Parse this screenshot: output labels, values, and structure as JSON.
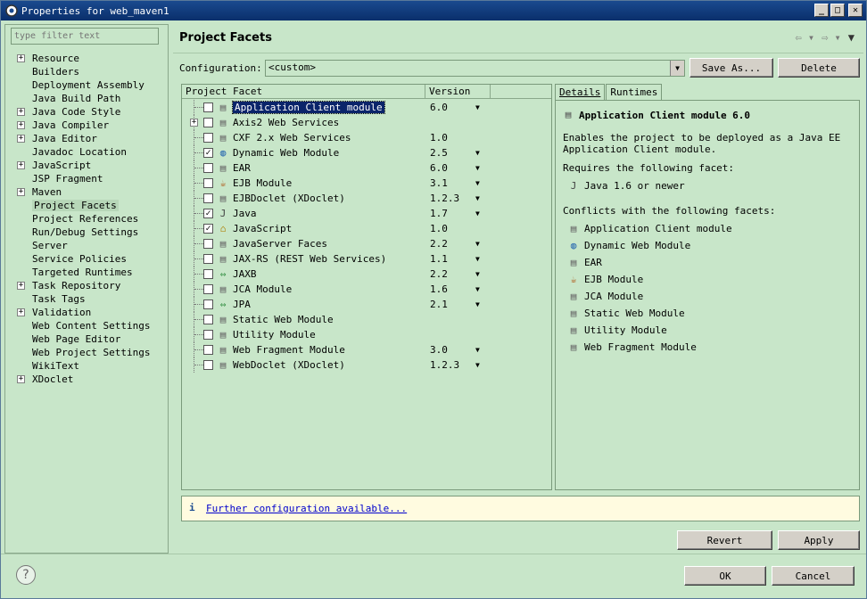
{
  "window": {
    "title": "Properties for web_maven1"
  },
  "sidebar": {
    "filter_placeholder": "type filter text",
    "items": [
      {
        "label": "Resource",
        "expandable": true
      },
      {
        "label": "Builders",
        "expandable": false
      },
      {
        "label": "Deployment Assembly",
        "expandable": false
      },
      {
        "label": "Java Build Path",
        "expandable": false
      },
      {
        "label": "Java Code Style",
        "expandable": true
      },
      {
        "label": "Java Compiler",
        "expandable": true
      },
      {
        "label": "Java Editor",
        "expandable": true
      },
      {
        "label": "Javadoc Location",
        "expandable": false
      },
      {
        "label": "JavaScript",
        "expandable": true
      },
      {
        "label": "JSP Fragment",
        "expandable": false
      },
      {
        "label": "Maven",
        "expandable": true
      },
      {
        "label": "Project Facets",
        "expandable": false,
        "selected": true
      },
      {
        "label": "Project References",
        "expandable": false
      },
      {
        "label": "Run/Debug Settings",
        "expandable": false
      },
      {
        "label": "Server",
        "expandable": false
      },
      {
        "label": "Service Policies",
        "expandable": false
      },
      {
        "label": "Targeted Runtimes",
        "expandable": false
      },
      {
        "label": "Task Repository",
        "expandable": true
      },
      {
        "label": "Task Tags",
        "expandable": false
      },
      {
        "label": "Validation",
        "expandable": true
      },
      {
        "label": "Web Content Settings",
        "expandable": false
      },
      {
        "label": "Web Page Editor",
        "expandable": false
      },
      {
        "label": "Web Project Settings",
        "expandable": false
      },
      {
        "label": "WikiText",
        "expandable": false
      },
      {
        "label": "XDoclet",
        "expandable": true
      }
    ]
  },
  "page": {
    "title": "Project Facets",
    "config_label": "Configuration:",
    "config_value": "<custom>",
    "save_as_label": "Save As...",
    "delete_label": "Delete"
  },
  "facets": {
    "col_facet": "Project Facet",
    "col_version": "Version",
    "rows": [
      {
        "name": "Application Client module",
        "version": "6.0",
        "checked": false,
        "dropdown": true,
        "icon": "page-icon",
        "selected": true
      },
      {
        "name": "Axis2 Web Services",
        "version": "",
        "checked": false,
        "dropdown": false,
        "icon": "page-icon",
        "expandable": true
      },
      {
        "name": "CXF 2.x Web Services",
        "version": "1.0",
        "checked": false,
        "dropdown": false,
        "icon": "page-icon"
      },
      {
        "name": "Dynamic Web Module",
        "version": "2.5",
        "checked": true,
        "dropdown": true,
        "icon": "globe-icon"
      },
      {
        "name": "EAR",
        "version": "6.0",
        "checked": false,
        "dropdown": true,
        "icon": "page-icon"
      },
      {
        "name": "EJB Module",
        "version": "3.1",
        "checked": false,
        "dropdown": true,
        "icon": "bean-icon"
      },
      {
        "name": "EJBDoclet (XDoclet)",
        "version": "1.2.3",
        "checked": false,
        "dropdown": true,
        "icon": "page-icon"
      },
      {
        "name": "Java",
        "version": "1.7",
        "checked": true,
        "dropdown": true,
        "icon": "java-icon"
      },
      {
        "name": "JavaScript",
        "version": "1.0",
        "checked": true,
        "dropdown": false,
        "icon": "js-icon"
      },
      {
        "name": "JavaServer Faces",
        "version": "2.2",
        "checked": false,
        "dropdown": true,
        "icon": "page-icon"
      },
      {
        "name": "JAX-RS (REST Web Services)",
        "version": "1.1",
        "checked": false,
        "dropdown": true,
        "icon": "page-icon"
      },
      {
        "name": "JAXB",
        "version": "2.2",
        "checked": false,
        "dropdown": true,
        "icon": "arrows-icon"
      },
      {
        "name": "JCA Module",
        "version": "1.6",
        "checked": false,
        "dropdown": true,
        "icon": "page-icon"
      },
      {
        "name": "JPA",
        "version": "2.1",
        "checked": false,
        "dropdown": true,
        "icon": "arrows-icon"
      },
      {
        "name": "Static Web Module",
        "version": "",
        "checked": false,
        "dropdown": false,
        "icon": "page-icon"
      },
      {
        "name": "Utility Module",
        "version": "",
        "checked": false,
        "dropdown": false,
        "icon": "page-icon"
      },
      {
        "name": "Web Fragment Module",
        "version": "3.0",
        "checked": false,
        "dropdown": true,
        "icon": "page-icon"
      },
      {
        "name": "WebDoclet (XDoclet)",
        "version": "1.2.3",
        "checked": false,
        "dropdown": true,
        "icon": "page-icon"
      }
    ]
  },
  "details": {
    "tab_details": "Details",
    "tab_runtimes": "Runtimes",
    "title": "Application Client module 6.0",
    "description": "Enables the project to be deployed as a Java EE Application Client module.",
    "requires_label": "Requires the following facet:",
    "requires": [
      {
        "name": "Java 1.6 or newer",
        "icon": "java-icon"
      }
    ],
    "conflicts_label": "Conflicts with the following facets:",
    "conflicts": [
      {
        "name": "Application Client module",
        "icon": "page-icon"
      },
      {
        "name": "Dynamic Web Module",
        "icon": "globe-icon"
      },
      {
        "name": "EAR",
        "icon": "page-icon"
      },
      {
        "name": "EJB Module",
        "icon": "bean-icon"
      },
      {
        "name": "JCA Module",
        "icon": "page-icon"
      },
      {
        "name": "Static Web Module",
        "icon": "page-icon"
      },
      {
        "name": "Utility Module",
        "icon": "page-icon"
      },
      {
        "name": "Web Fragment Module",
        "icon": "page-icon"
      }
    ]
  },
  "info": {
    "link": "Further configuration available..."
  },
  "actions": {
    "revert": "Revert",
    "apply": "Apply",
    "ok": "OK",
    "cancel": "Cancel"
  }
}
